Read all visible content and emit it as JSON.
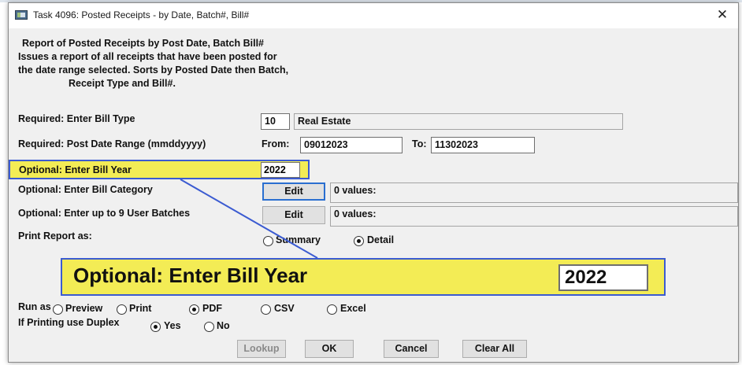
{
  "window": {
    "title": "Task 4096: Posted Receipts - by Date, Batch#, Bill#",
    "close_symbol": "✕"
  },
  "description": [
    "Report of Posted Receipts by Post Date, Batch  Bill#",
    "Issues a report of all receipts that have been posted for",
    "the date range selected. Sorts by Posted Date then Batch,",
    "Receipt Type and Bill#."
  ],
  "bill_type": {
    "label": "Required: Enter Bill Type",
    "code": "10",
    "name": "Real Estate"
  },
  "post_date": {
    "label": "Required: Post Date Range (mmddyyyy)",
    "from_label": "From:",
    "from_value": "09012023",
    "to_label": "To:",
    "to_value": "11302023"
  },
  "bill_year": {
    "label": "Optional: Enter Bill Year",
    "value": "2022"
  },
  "bill_category": {
    "label": "Optional: Enter Bill Category",
    "button": "Edit",
    "values_text": "0 values:"
  },
  "user_batches": {
    "label": "Optional: Enter up to 9 User Batches",
    "button": "Edit",
    "values_text": "0 values:"
  },
  "print_as": {
    "label": "Print Report as:",
    "options": [
      "Summary",
      "Detail"
    ],
    "selected": "Detail"
  },
  "run_as": {
    "label": "Run as",
    "options": [
      "Preview",
      "Print",
      "PDF",
      "CSV",
      "Excel"
    ],
    "selected": "PDF"
  },
  "duplex": {
    "label": "If Printing use Duplex",
    "options": [
      "Yes",
      "No"
    ],
    "selected": "Yes"
  },
  "buttons": {
    "lookup": "Lookup",
    "ok": "OK",
    "cancel": "Cancel",
    "clear_all": "Clear All"
  },
  "callout": {
    "label": "Optional: Enter Bill Year",
    "value": "2022"
  },
  "colors": {
    "highlight": "#f3ec55",
    "callout_border": "#3b5bd1",
    "focus_border": "#2a6fd0"
  }
}
